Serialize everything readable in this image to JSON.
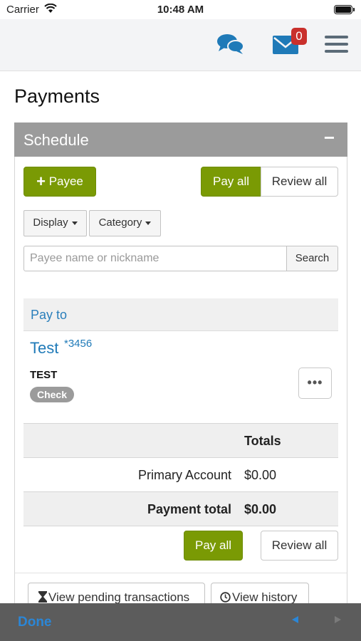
{
  "status_bar": {
    "carrier": "Carrier",
    "time": "10:48 AM"
  },
  "nav": {
    "mail_badge": "0"
  },
  "page": {
    "title": "Payments"
  },
  "panel": {
    "title": "Schedule",
    "collapse_symbol": "−",
    "add_payee_label": "Payee",
    "pay_all_label": "Pay all",
    "review_all_label": "Review all",
    "display_label": "Display",
    "category_label": "Category",
    "search_placeholder": "Payee name or nickname",
    "search_label": "Search",
    "pay_to_label": "Pay to",
    "payee": {
      "name": "Test",
      "account": "*3456",
      "nickname": "TEST",
      "method": "Check",
      "more": "•••"
    },
    "totals": {
      "header": "Totals",
      "rows": [
        {
          "label": "Primary Account",
          "value": "$0.00"
        },
        {
          "label": "Payment total",
          "value": "$0.00"
        }
      ]
    },
    "pending_label": "View pending transactions",
    "history_label": "View history"
  },
  "toolbar": {
    "done_label": "Done"
  },
  "colors": {
    "accent_green": "#7a9a04",
    "link_blue": "#1f7ab8",
    "badge_red": "#c9302c"
  },
  "icons": [
    "wifi-icon",
    "battery-icon",
    "chat-icon",
    "mail-icon",
    "menu-icon",
    "plus-icon",
    "hourglass-icon",
    "clock-icon"
  ]
}
